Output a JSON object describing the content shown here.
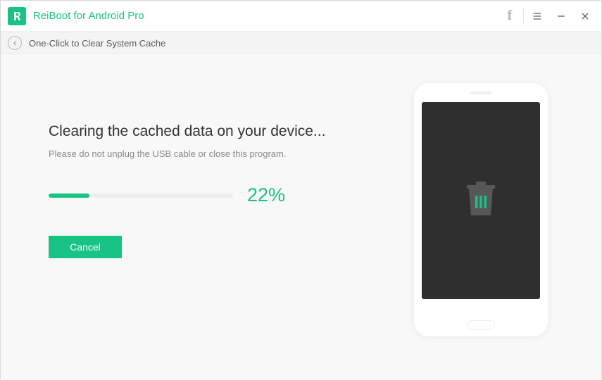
{
  "header": {
    "app_title": "ReiBoot for Android Pro"
  },
  "breadcrumb": {
    "title": "One-Click to Clear System Cache"
  },
  "main": {
    "heading": "Clearing the cached data on your device...",
    "subtext": "Please do not unplug the USB cable or close this program.",
    "progress_pct": 22,
    "progress_label": "22%",
    "cancel_label": "Cancel"
  },
  "colors": {
    "accent": "#19c285"
  }
}
